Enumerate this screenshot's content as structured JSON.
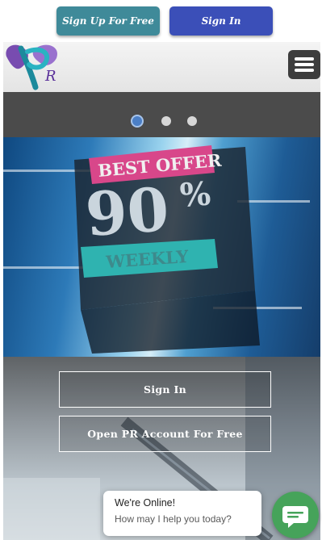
{
  "top_bar": {
    "signup_label": "Sign Up For Free",
    "signin_label": "Sign In"
  },
  "header": {
    "logo_icon": "pr-logo-icon",
    "menu_icon": "hamburger-menu-icon"
  },
  "slider": {
    "slides_count": 3,
    "active_index": 0
  },
  "banner": {
    "line1": "BEST OFFER",
    "percent": "90",
    "percent_sign": "%",
    "line3": "WEEKLY"
  },
  "actions": {
    "signin_label": "Sign In",
    "open_account_label": "Open PR Account For Free"
  },
  "chat": {
    "title": "We're Online!",
    "subtitle": "How may I help you today?",
    "icon": "chat-bubble-icon"
  },
  "colors": {
    "signup_button": "#3f8a99",
    "signin_button": "#3b4fb8",
    "chat_green": "#46a35a",
    "offer_pink": "#d8478a",
    "offer_teal": "#2fb3b0"
  }
}
